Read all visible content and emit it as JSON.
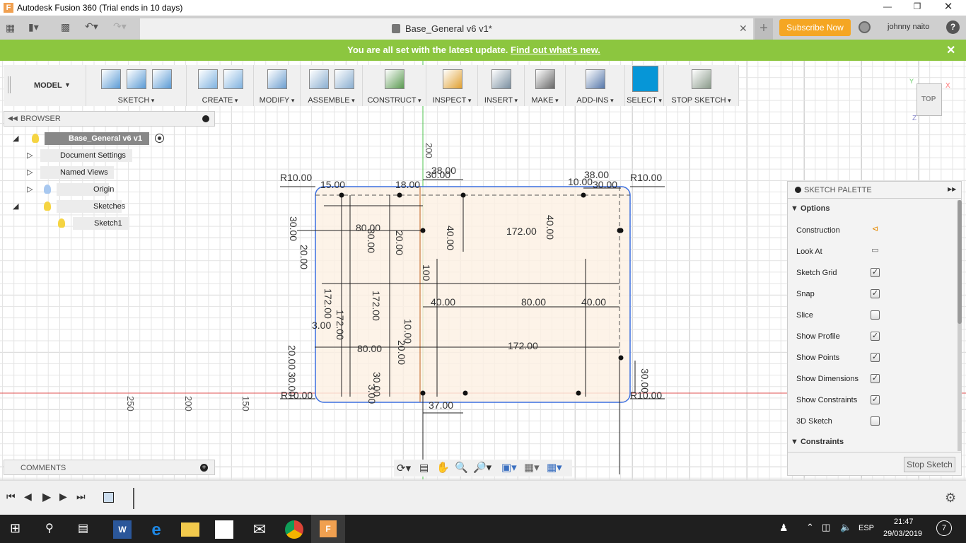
{
  "window": {
    "title": "Autodesk Fusion 360 (Trial ends in 10 days)"
  },
  "tabs": {
    "doc_title": "Base_General v6 v1*",
    "subscribe": "Subscribe Now",
    "user": "johnny naito"
  },
  "banner": {
    "text": "You are all set with the latest update.",
    "link": "Find out what's new."
  },
  "toolbar": {
    "workspace": "MODEL",
    "groups": [
      "SKETCH",
      "CREATE",
      "MODIFY",
      "ASSEMBLE",
      "CONSTRUCT",
      "INSPECT",
      "INSERT",
      "MAKE",
      "ADD-INS",
      "SELECT",
      "STOP SKETCH"
    ]
  },
  "browser": {
    "title": "BROWSER",
    "items": [
      {
        "label": "Base_General v6 v1"
      },
      {
        "label": "Document Settings"
      },
      {
        "label": "Named Views"
      },
      {
        "label": "Origin"
      },
      {
        "label": "Sketches"
      },
      {
        "label": "Sketch1"
      }
    ]
  },
  "comments": {
    "title": "COMMENTS"
  },
  "viewcube": {
    "face": "TOP",
    "x": "X",
    "y": "Y",
    "z": "Z"
  },
  "palette": {
    "title": "SKETCH PALETTE",
    "section_options": "Options",
    "section_constraints": "Constraints",
    "stop_button": "Stop Sketch",
    "options": [
      {
        "label": "Construction",
        "type": "icon"
      },
      {
        "label": "Look At",
        "type": "icon"
      },
      {
        "label": "Sketch Grid",
        "checked": true
      },
      {
        "label": "Snap",
        "checked": true
      },
      {
        "label": "Slice",
        "checked": false
      },
      {
        "label": "Show Profile",
        "checked": true
      },
      {
        "label": "Show Points",
        "checked": true
      },
      {
        "label": "Show Dimensions",
        "checked": true
      },
      {
        "label": "Show Constraints",
        "checked": true
      },
      {
        "label": "3D Sketch",
        "checked": false
      }
    ]
  },
  "axis_ticks": {
    "h": [
      "250",
      "200",
      "150"
    ],
    "v": [
      "200",
      "100"
    ]
  },
  "dimensions": [
    "R10.00",
    "R10.00",
    "R10.00",
    "R10.00",
    "15.00",
    "18.00",
    "38.00",
    "30.00",
    "38.00",
    "10.00",
    "30.00",
    "30.00",
    "20.00",
    "80.00",
    "30.00",
    "20.00",
    "40.00",
    "172.00",
    "40.00",
    "172.00",
    "172.00",
    "172.00",
    "40.00",
    "80.00",
    "40.00",
    "3.00",
    "20.00",
    "30.00",
    "80.00",
    "172.00",
    "30.00",
    "3.00",
    "37.00",
    "30.00",
    "10.00",
    "20.00",
    "100"
  ],
  "taskbar": {
    "lang": "ESP",
    "time": "21:47",
    "date": "29/03/2019",
    "notifications": "7"
  },
  "colors": {
    "banner": "#8cc63f",
    "subscribe": "#f5a623",
    "select_active": "#0696d7",
    "sketch_line": "#3b6fe0",
    "x_axis": "#e05050",
    "y_axis": "#4fc34f"
  }
}
